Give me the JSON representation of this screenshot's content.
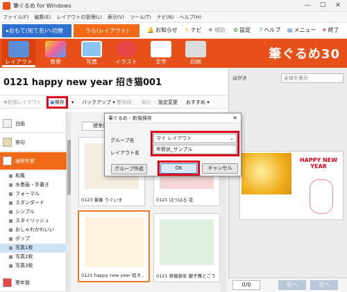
{
  "window": {
    "title": "筆ぐるめ for Windows",
    "controls": {
      "minimize": "—",
      "maximize": "☐",
      "close": "✕"
    }
  },
  "menubar": [
    "ファイル(F)",
    "編集(E)",
    "レイアウトの管理(L)",
    "表示(V)",
    "ツール(T)",
    "ナビ(N)",
    "ヘルプ(H)"
  ],
  "modes": {
    "addr": "▸おもて(宛て名)へ切替",
    "layout": "うら(レイアウト)"
  },
  "toolbar": {
    "notice": "お知らせ",
    "navi": "ナビ",
    "hojo": "補助",
    "settings": "設定",
    "help": "ヘルプ",
    "menu": "メニュー",
    "exit": "終了"
  },
  "ribbon": {
    "items": [
      "レイアウト",
      "背景",
      "写真",
      "イラスト",
      "文字",
      "印刷"
    ],
    "logo": "筆ぐるめ30"
  },
  "left": {
    "headline": "0121  happy new year  招き猫001",
    "tools": {
      "new_layout": "新規レイアウト",
      "save": "保存",
      "backup": "バックアップ",
      "delete": "削除",
      "import": "取込",
      "change_settings": "設定変更",
      "recommended": "おすすめ"
    },
    "tab_standard": "標準縦表",
    "categories": {
      "blank": "白紙",
      "haiku": "俳句",
      "nenga": "通常年賀",
      "kannen": "寒年賀"
    },
    "subcategories": [
      "和風",
      "水墨画・手書き",
      "フォーマル",
      "スタンダード",
      "シンプル",
      "スタイリッシュ",
      "おしゃれかわいい",
      "ポップ",
      "写真1枚",
      "写真2枚",
      "写真3枚"
    ],
    "cards": [
      {
        "caption": "0123 賀春 うぐいす"
      },
      {
        "caption": "0121 はつはる 花"
      },
      {
        "caption": "0121  happy new year  招き…"
      },
      {
        "caption": "0121 恭賀新年 獅子舞とごう"
      }
    ]
  },
  "right": {
    "label": "はがき",
    "select": "全体を表示",
    "page_counter": "0/0",
    "prev": "前へ",
    "next": "次へ"
  },
  "preview": {
    "banner": "HAPPY NEW YEAR"
  },
  "dialog": {
    "title": "筆ぐるめ - 新規保存",
    "group_label": "グループ名",
    "group_value": "マイ レイアウト",
    "name_label": "レイアウト名",
    "name_value": "年賀状_サンプル",
    "create_group": "グループ作成",
    "ok": "OK",
    "cancel": "キャンセル"
  },
  "colors": {
    "brand": "#e8501a",
    "accent_blue": "#2f6fd0",
    "highlight": "#e0001b"
  }
}
